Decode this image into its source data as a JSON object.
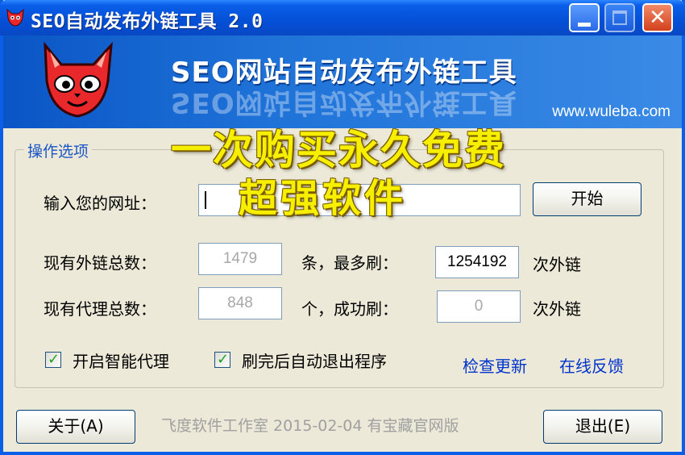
{
  "window": {
    "title": "SEO自动发布外链工具 2.0",
    "close_glyph": "✕"
  },
  "banner": {
    "title": "SEO网站自动发布外链工具",
    "url": "www.wuleba.com"
  },
  "promo": {
    "line1": "一次购买永久免费",
    "line2": "超强软件"
  },
  "group": {
    "legend": "操作选项"
  },
  "url_row": {
    "label": "输入您的网址：",
    "value": "",
    "start_button": "开始"
  },
  "stats": {
    "links_label": "现有外链总数：",
    "links_value": "1479",
    "links_unit": "条，最多刷：",
    "max_value": "1254192",
    "max_unit": "次外链",
    "proxy_label": "现有代理总数：",
    "proxy_value": "848",
    "proxy_unit": "个，成功刷：",
    "success_value": "0",
    "success_unit": "次外链"
  },
  "options": {
    "smart_proxy_label": "开启智能代理",
    "smart_proxy_checked": true,
    "auto_exit_label": "刷完后自动退出程序",
    "auto_exit_checked": true,
    "check_update": "检查更新",
    "feedback": "在线反馈"
  },
  "footer": {
    "about_button": "关于(A)",
    "info": "飞度软件工作室 2015-02-04 有宝藏官网版",
    "exit_button": "退出(E)"
  },
  "colors": {
    "titlebar": "#0a5ee8",
    "link": "#0033cc",
    "legend": "#1a55c8",
    "promo": "#f6f000"
  }
}
